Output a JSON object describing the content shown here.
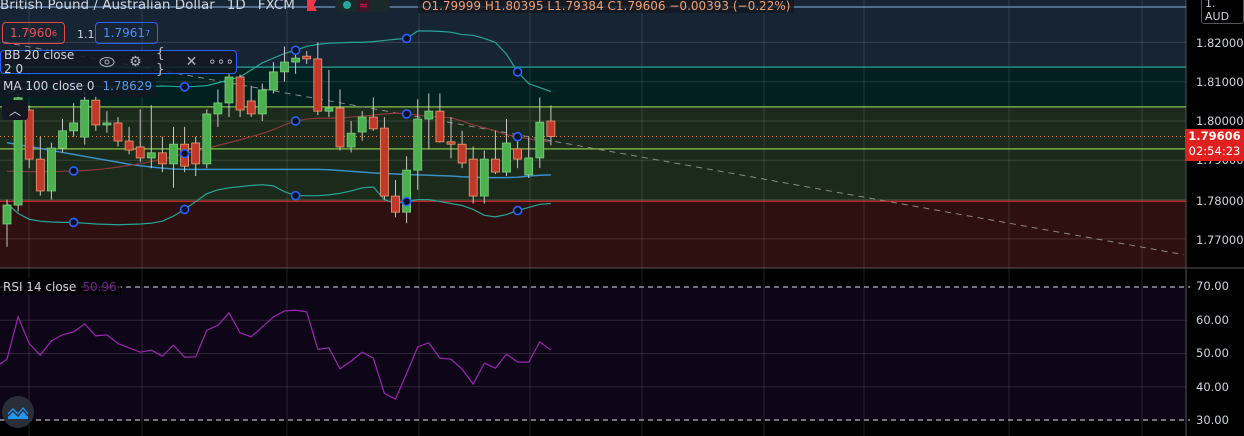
{
  "header": {
    "symbol": "British Pound / Australian Dollar",
    "interval": "1D",
    "exchange": "FXCM",
    "ohlc": {
      "open": "O1.79999",
      "high": "H1.80395",
      "low": "L1.79384",
      "close": "C1.79606",
      "change": "−0.00393 (−0.22%)"
    }
  },
  "trade": {
    "sell_price": "1.7960",
    "sell_sup": "6",
    "spread": "1.1",
    "buy_price": "1.7961",
    "buy_sup": "7"
  },
  "indicators": {
    "bb": {
      "label": "BB 20 close 2 0",
      "icons": [
        "eye-icon",
        "gear-icon",
        "source-code-icon",
        "close-icon",
        "more-icon"
      ]
    },
    "ma": {
      "label": "MA 100 close 0",
      "value": "1.78629"
    },
    "rsi": {
      "label": "RSI 14 close",
      "value": "50.96"
    }
  },
  "price_axis": {
    "currency": "AUD",
    "top_label": "1.",
    "ticks": [
      "1.82000",
      "1.81000",
      "1.80000",
      "1.79000",
      "1.78000",
      "1.77000"
    ],
    "last_price": "1.79606",
    "countdown": "02:54:23"
  },
  "rsi_axis": {
    "ticks": [
      "70.00",
      "60.00",
      "50.00",
      "40.00",
      "30.00"
    ]
  },
  "colors": {
    "up": "#4caf50",
    "down": "#c0392b",
    "bb_band": "#26a69a",
    "bb_basis": "#8b3a3a",
    "ma": "#3a8fc8",
    "rsi": "#9c27b0",
    "last_price": "#e0201f"
  },
  "chart_data": {
    "type": "candlestick",
    "title": "British Pound / Australian Dollar 1D FXCM",
    "ylim": [
      1.7648,
      1.8305
    ],
    "levels": [
      1.8137,
      1.8036,
      1.7929,
      1.7796
    ],
    "last_close": 1.79606,
    "candles": [
      [
        1.7738,
        1.78,
        1.768,
        1.7786
      ],
      [
        1.7786,
        1.807,
        1.777,
        1.8059
      ],
      [
        1.8028,
        1.804,
        1.788,
        1.7903
      ],
      [
        1.7903,
        1.796,
        1.781,
        1.7822
      ],
      [
        1.7822,
        1.7945,
        1.78,
        1.7931
      ],
      [
        1.7931,
        1.8005,
        1.792,
        1.7975
      ],
      [
        1.7975,
        1.8045,
        1.796,
        1.7995
      ],
      [
        1.7959,
        1.8075,
        1.794,
        1.8053
      ],
      [
        1.8053,
        1.8065,
        1.7975,
        1.799
      ],
      [
        1.799,
        1.8025,
        1.797,
        1.7995
      ],
      [
        1.7995,
        1.801,
        1.7935,
        1.7949
      ],
      [
        1.7949,
        1.7985,
        1.7915,
        1.7926
      ],
      [
        1.7934,
        1.803,
        1.7895,
        1.7906
      ],
      [
        1.7906,
        1.804,
        1.788,
        1.7919
      ],
      [
        1.7919,
        1.796,
        1.787,
        1.7891
      ],
      [
        1.7891,
        1.7985,
        1.783,
        1.7941
      ],
      [
        1.7941,
        1.7985,
        1.787,
        1.7885
      ],
      [
        1.7944,
        1.796,
        1.786,
        1.7891
      ],
      [
        1.7891,
        1.803,
        1.788,
        1.8018
      ],
      [
        1.8018,
        1.808,
        1.7985,
        1.8046
      ],
      [
        1.8046,
        1.812,
        1.801,
        1.8112
      ],
      [
        1.8112,
        1.8118,
        1.801,
        1.8028
      ],
      [
        1.8051,
        1.809,
        1.801,
        1.8018
      ],
      [
        1.8018,
        1.8095,
        1.8,
        1.8079
      ],
      [
        1.8079,
        1.815,
        1.807,
        1.8125
      ],
      [
        1.8125,
        1.819,
        1.81,
        1.815
      ],
      [
        1.815,
        1.8185,
        1.812,
        1.816
      ],
      [
        1.8165,
        1.8178,
        1.8145,
        1.8158
      ],
      [
        1.8158,
        1.82,
        1.8015,
        1.8025
      ],
      [
        1.8025,
        1.813,
        1.801,
        1.8033
      ],
      [
        1.8033,
        1.808,
        1.7925,
        1.7934
      ],
      [
        1.7934,
        1.8,
        1.792,
        1.7969
      ],
      [
        1.7972,
        1.8025,
        1.795,
        1.801
      ],
      [
        1.801,
        1.806,
        1.7975,
        1.798
      ],
      [
        1.7982,
        1.801,
        1.78,
        1.7809
      ],
      [
        1.7809,
        1.785,
        1.7755,
        1.7768
      ],
      [
        1.7768,
        1.791,
        1.774,
        1.7875
      ],
      [
        1.7875,
        1.8055,
        1.7825,
        1.8005
      ],
      [
        1.8005,
        1.807,
        1.793,
        1.8025
      ],
      [
        1.8025,
        1.807,
        1.7945,
        1.7947
      ],
      [
        1.7947,
        1.801,
        1.7905,
        1.7941
      ],
      [
        1.7941,
        1.7975,
        1.788,
        1.7893
      ],
      [
        1.7903,
        1.7935,
        1.779,
        1.7809
      ],
      [
        1.7809,
        1.7925,
        1.779,
        1.7903
      ],
      [
        1.7903,
        1.7975,
        1.7865,
        1.787
      ],
      [
        1.787,
        1.8005,
        1.786,
        1.7944
      ],
      [
        1.7929,
        1.7965,
        1.788,
        1.7903
      ],
      [
        1.7863,
        1.796,
        1.7855,
        1.7906
      ],
      [
        1.7906,
        1.806,
        1.788,
        1.7997
      ],
      [
        1.79999,
        1.80395,
        1.79384,
        1.79606
      ]
    ],
    "bb_upper": [
      1.807,
      1.808,
      1.8085,
      1.8087,
      1.8087,
      1.8088,
      1.8089,
      1.809,
      1.8088,
      1.8087,
      1.8087,
      1.8088,
      1.8089,
      1.8088,
      1.8089,
      1.8088,
      1.8087,
      1.8088,
      1.809,
      1.8097,
      1.8105,
      1.8112,
      1.813,
      1.8148,
      1.816,
      1.8172,
      1.818,
      1.819,
      1.8195,
      1.8198,
      1.8199,
      1.82,
      1.82,
      1.8202,
      1.8205,
      1.8208,
      1.821,
      1.8229,
      1.8229,
      1.8228,
      1.8226,
      1.822,
      1.8218,
      1.821,
      1.82,
      1.817,
      1.8125,
      1.8095,
      1.8085,
      1.8075
    ],
    "bb_lower": [
      1.779,
      1.7765,
      1.775,
      1.7745,
      1.7743,
      1.7742,
      1.7742,
      1.774,
      1.7738,
      1.7737,
      1.7736,
      1.7737,
      1.7738,
      1.774,
      1.7745,
      1.7758,
      1.7775,
      1.7795,
      1.7815,
      1.7825,
      1.783,
      1.7833,
      1.7836,
      1.7838,
      1.7835,
      1.782,
      1.781,
      1.781,
      1.781,
      1.7812,
      1.7816,
      1.7822,
      1.783,
      1.7832,
      1.78,
      1.779,
      1.7795,
      1.78,
      1.78,
      1.7795,
      1.779,
      1.7785,
      1.7775,
      1.776,
      1.7756,
      1.7762,
      1.7772,
      1.778,
      1.7788,
      1.779
    ],
    "bb_basis": [
      1.7872,
      1.7872,
      1.7871,
      1.7871,
      1.7871,
      1.7872,
      1.7873,
      1.7874,
      1.7876,
      1.7879,
      1.7883,
      1.7887,
      1.7891,
      1.7897,
      1.7903,
      1.791,
      1.7917,
      1.7923,
      1.793,
      1.7938,
      1.7945,
      1.7952,
      1.796,
      1.7968,
      1.7978,
      1.799,
      1.8,
      1.8005,
      1.8007,
      1.8007,
      1.8008,
      1.801,
      1.8012,
      1.8015,
      1.8018,
      1.802,
      1.8018,
      1.8015,
      1.8012,
      1.801,
      1.8008,
      1.8,
      1.799,
      1.7983,
      1.7975,
      1.7965,
      1.796,
      1.7955,
      1.795,
      1.7947
    ],
    "ma100": [
      1.7945,
      1.794,
      1.7935,
      1.793,
      1.7925,
      1.792,
      1.7915,
      1.791,
      1.7905,
      1.79,
      1.7895,
      1.789,
      1.7886,
      1.7883,
      1.788,
      1.7878,
      1.7877,
      1.7877,
      1.7877,
      1.7877,
      1.7877,
      1.7877,
      1.7877,
      1.7877,
      1.7877,
      1.7877,
      1.7877,
      1.7877,
      1.7877,
      1.7876,
      1.7874,
      1.7872,
      1.787,
      1.7868,
      1.7866,
      1.7865,
      1.7864,
      1.7863,
      1.7862,
      1.7861,
      1.786,
      1.7858,
      1.7857,
      1.7856,
      1.7856,
      1.7856,
      1.7857,
      1.786,
      1.7862,
      1.7863
    ],
    "bb_markers": [
      6,
      16,
      26,
      36,
      46
    ],
    "trendline": {
      "from": [
        1.827,
        -14
      ],
      "to": [
        1.766,
        106
      ]
    },
    "rsi": {
      "ylim": [
        25,
        75
      ],
      "bands": [
        70,
        30
      ],
      "values": [
        46,
        48.3,
        61,
        53,
        49.5,
        53.8,
        55.6,
        56.5,
        58.9,
        55.3,
        55.6,
        53,
        51.7,
        50.4,
        51,
        49.2,
        52.5,
        48.9,
        49,
        57,
        58.5,
        62.2,
        56.2,
        55,
        58,
        61,
        62.8,
        63,
        62.5,
        51.3,
        51.7,
        45.4,
        47.7,
        50.4,
        48.6,
        38,
        36.3,
        44,
        52,
        53.2,
        48.6,
        48.3,
        45.3,
        40.8,
        47.1,
        45.6,
        49.8,
        47.4,
        47.4,
        53.5,
        51
      ]
    }
  }
}
